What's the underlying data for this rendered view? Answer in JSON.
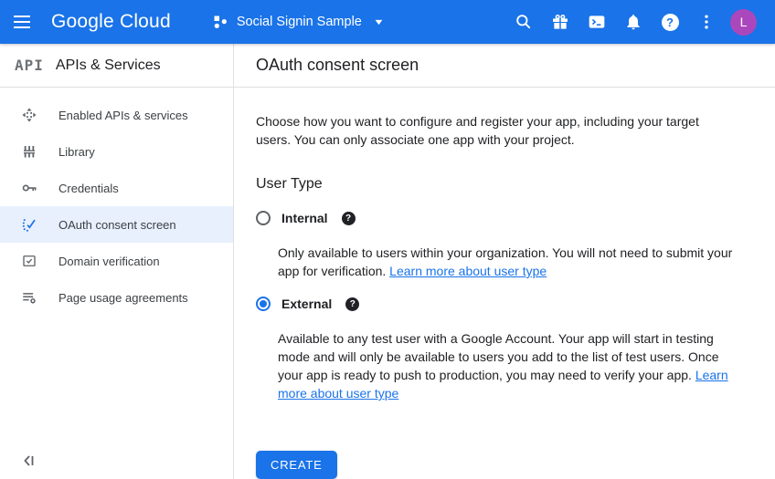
{
  "colors": {
    "topbar-bg": "#1a73e8",
    "accent": "#1a73e8",
    "link": "#1a73e8",
    "avatar-bg": "#ab47bc",
    "selected-bg": "#e8f0fe",
    "icon-gray": "#5f6368",
    "text-primary": "#202124",
    "text-secondary": "#3c4043",
    "divider": "#e0e0e0"
  },
  "topbar": {
    "logo_text": "Google Cloud",
    "project_name": "Social Signin Sample",
    "caret_glyph": "▼",
    "help_glyph": "?",
    "avatar_initial": "L"
  },
  "sidebar": {
    "logo_text": "API",
    "title": "APIs & Services",
    "items": [
      {
        "label": "Enabled APIs & services",
        "selected": false
      },
      {
        "label": "Library",
        "selected": false
      },
      {
        "label": "Credentials",
        "selected": false
      },
      {
        "label": "OAuth consent screen",
        "selected": true
      },
      {
        "label": "Domain verification",
        "selected": false
      },
      {
        "label": "Page usage agreements",
        "selected": false
      }
    ]
  },
  "main": {
    "title": "OAuth consent screen",
    "intro": "Choose how you want to configure and register your app, including your target users. You can only associate one app with your project.",
    "section_title": "User Type",
    "options": [
      {
        "label": "Internal",
        "selected": false,
        "help_glyph": "?",
        "description": "Only available to users within your organization. You will not need to submit your app for verification. ",
        "link_text": "Learn more about user type"
      },
      {
        "label": "External",
        "selected": true,
        "help_glyph": "?",
        "description": "Available to any test user with a Google Account. Your app will start in testing mode and will only be available to users you add to the list of test users. Once your app is ready to push to production, you may need to verify your app. ",
        "link_text": "Learn more about user type"
      }
    ],
    "create_label": "CREATE"
  }
}
